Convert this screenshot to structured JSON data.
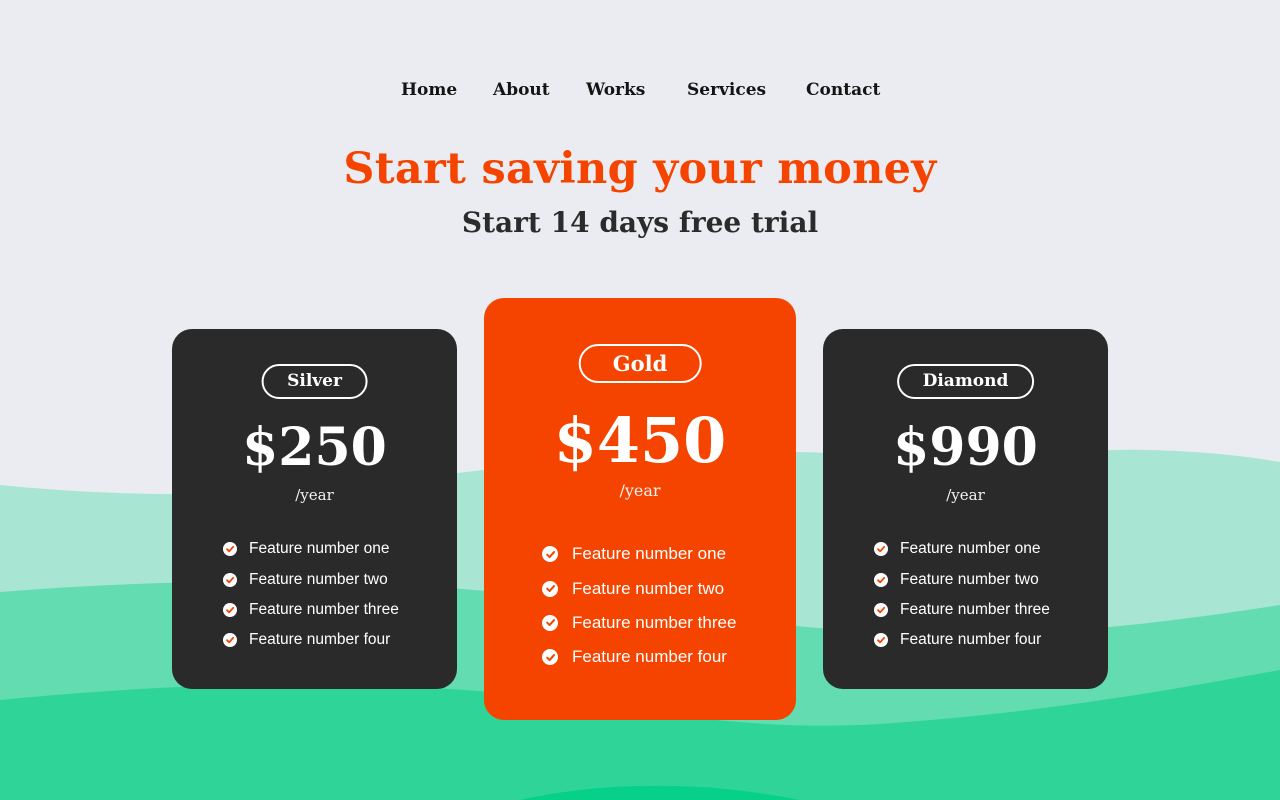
{
  "nav": {
    "items": [
      {
        "label": "Home"
      },
      {
        "label": "About"
      },
      {
        "label": "Works"
      },
      {
        "label": "Services"
      },
      {
        "label": "Contact"
      }
    ]
  },
  "hero": {
    "title": "Start saving your money",
    "subtitle": "Start 14 days free trial"
  },
  "plans": [
    {
      "name": "Silver",
      "price": "$250",
      "period": "/year",
      "features": [
        "Feature number one",
        "Feature number two",
        "Feature number three",
        "Feature number four"
      ]
    },
    {
      "name": "Gold",
      "price": "$450",
      "period": "/year",
      "features": [
        "Feature number one",
        "Feature number two",
        "Feature number three",
        "Feature number four"
      ]
    },
    {
      "name": "Diamond",
      "price": "$990",
      "period": "/year",
      "features": [
        "Feature number one",
        "Feature number two",
        "Feature number three",
        "Feature number four"
      ]
    }
  ],
  "icons": {
    "feature_icon": "check-circle-icon"
  },
  "colors": {
    "background": "#ebecf1",
    "accent": "#f54400",
    "card_dark": "#2a2a2a",
    "wave_light": "#a8e5d3",
    "wave_mid": "#63dcb1",
    "wave_dark": "#2fd598",
    "heading_dark": "#2b2b2b"
  }
}
